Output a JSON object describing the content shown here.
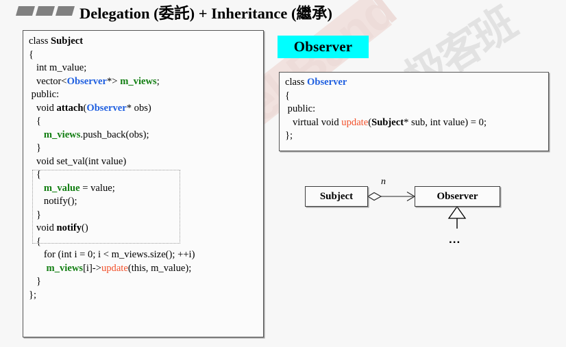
{
  "header": {
    "title": "Delegation (委託) + Inheritance (繼承)",
    "decoration_squares": 3
  },
  "watermark": {
    "latin_text": "GeekBand",
    "cjk_text": "极客班",
    "latin_color": "#eddcd9",
    "cjk_color": "#e2e2e2"
  },
  "subject_code": {
    "lines": [
      [
        {
          "t": "class ",
          "c": "plain"
        },
        {
          "t": "Subject",
          "c": "bold"
        }
      ],
      [
        {
          "t": "{",
          "c": "plain"
        }
      ],
      [
        {
          "t": "   int m_value;",
          "c": "plain"
        }
      ],
      [
        {
          "t": "   vector<",
          "c": "plain"
        },
        {
          "t": "Observer",
          "c": "blue"
        },
        {
          "t": "*> ",
          "c": "plain"
        },
        {
          "t": "m_views",
          "c": "green"
        },
        {
          "t": ";",
          "c": "plain"
        }
      ],
      [
        {
          "t": " public:",
          "c": "plain"
        }
      ],
      [
        {
          "t": "   void ",
          "c": "plain"
        },
        {
          "t": "attach",
          "c": "bold"
        },
        {
          "t": "(",
          "c": "plain"
        },
        {
          "t": "Observer",
          "c": "blue"
        },
        {
          "t": "* obs)",
          "c": "plain"
        }
      ],
      [
        {
          "t": "   {",
          "c": "plain"
        }
      ],
      [
        {
          "t": "      ",
          "c": "plain"
        },
        {
          "t": "m_views",
          "c": "green"
        },
        {
          "t": ".push_back(obs);",
          "c": "plain"
        }
      ],
      [
        {
          "t": "   }",
          "c": "plain"
        }
      ],
      [
        {
          "t": "   void set_val(int value)",
          "c": "plain"
        }
      ],
      [
        {
          "t": "   {",
          "c": "plain"
        }
      ],
      [
        {
          "t": "      ",
          "c": "plain"
        },
        {
          "t": "m_value",
          "c": "green"
        },
        {
          "t": " = value;",
          "c": "plain"
        }
      ],
      [
        {
          "t": "      notify();",
          "c": "plain"
        }
      ],
      [
        {
          "t": "   }",
          "c": "plain"
        }
      ],
      [
        {
          "t": "   void ",
          "c": "plain"
        },
        {
          "t": "notify",
          "c": "bold"
        },
        {
          "t": "()",
          "c": "plain"
        }
      ],
      [
        {
          "t": "   {",
          "c": "plain"
        }
      ],
      [
        {
          "t": "      for (int i = 0; i < m_views.size(); ++i)",
          "c": "plain"
        }
      ],
      [
        {
          "t": "       ",
          "c": "plain"
        },
        {
          "t": "m_views",
          "c": "green"
        },
        {
          "t": "[i]->",
          "c": "plain"
        },
        {
          "t": "update",
          "c": "red"
        },
        {
          "t": "(this, m_value);",
          "c": "plain"
        }
      ],
      [
        {
          "t": "   }",
          "c": "plain"
        }
      ],
      [
        {
          "t": "};",
          "c": "plain"
        }
      ]
    ]
  },
  "observer_chip": {
    "label": "Observer",
    "background": "#00ffff"
  },
  "observer_code": {
    "lines": [
      [
        {
          "t": "class ",
          "c": "plain"
        },
        {
          "t": "Observer",
          "c": "blue"
        }
      ],
      [
        {
          "t": "{",
          "c": "plain"
        }
      ],
      [
        {
          "t": " public:",
          "c": "plain"
        }
      ],
      [
        {
          "t": "   virtual void ",
          "c": "plain"
        },
        {
          "t": "update",
          "c": "red"
        },
        {
          "t": "(",
          "c": "plain"
        },
        {
          "t": "Subject",
          "c": "bold"
        },
        {
          "t": "* sub, int value) = 0;",
          "c": "plain"
        }
      ],
      [
        {
          "t": "};",
          "c": "plain"
        }
      ]
    ]
  },
  "uml": {
    "subject_label": "Subject",
    "observer_label": "Observer",
    "multiplicity": "n",
    "subclass_placeholder": "...",
    "relations": [
      {
        "kind": "aggregation",
        "from": "Subject",
        "to": "Observer",
        "multiplicity": "n"
      },
      {
        "kind": "inheritance",
        "from": "...",
        "to": "Observer"
      }
    ]
  }
}
